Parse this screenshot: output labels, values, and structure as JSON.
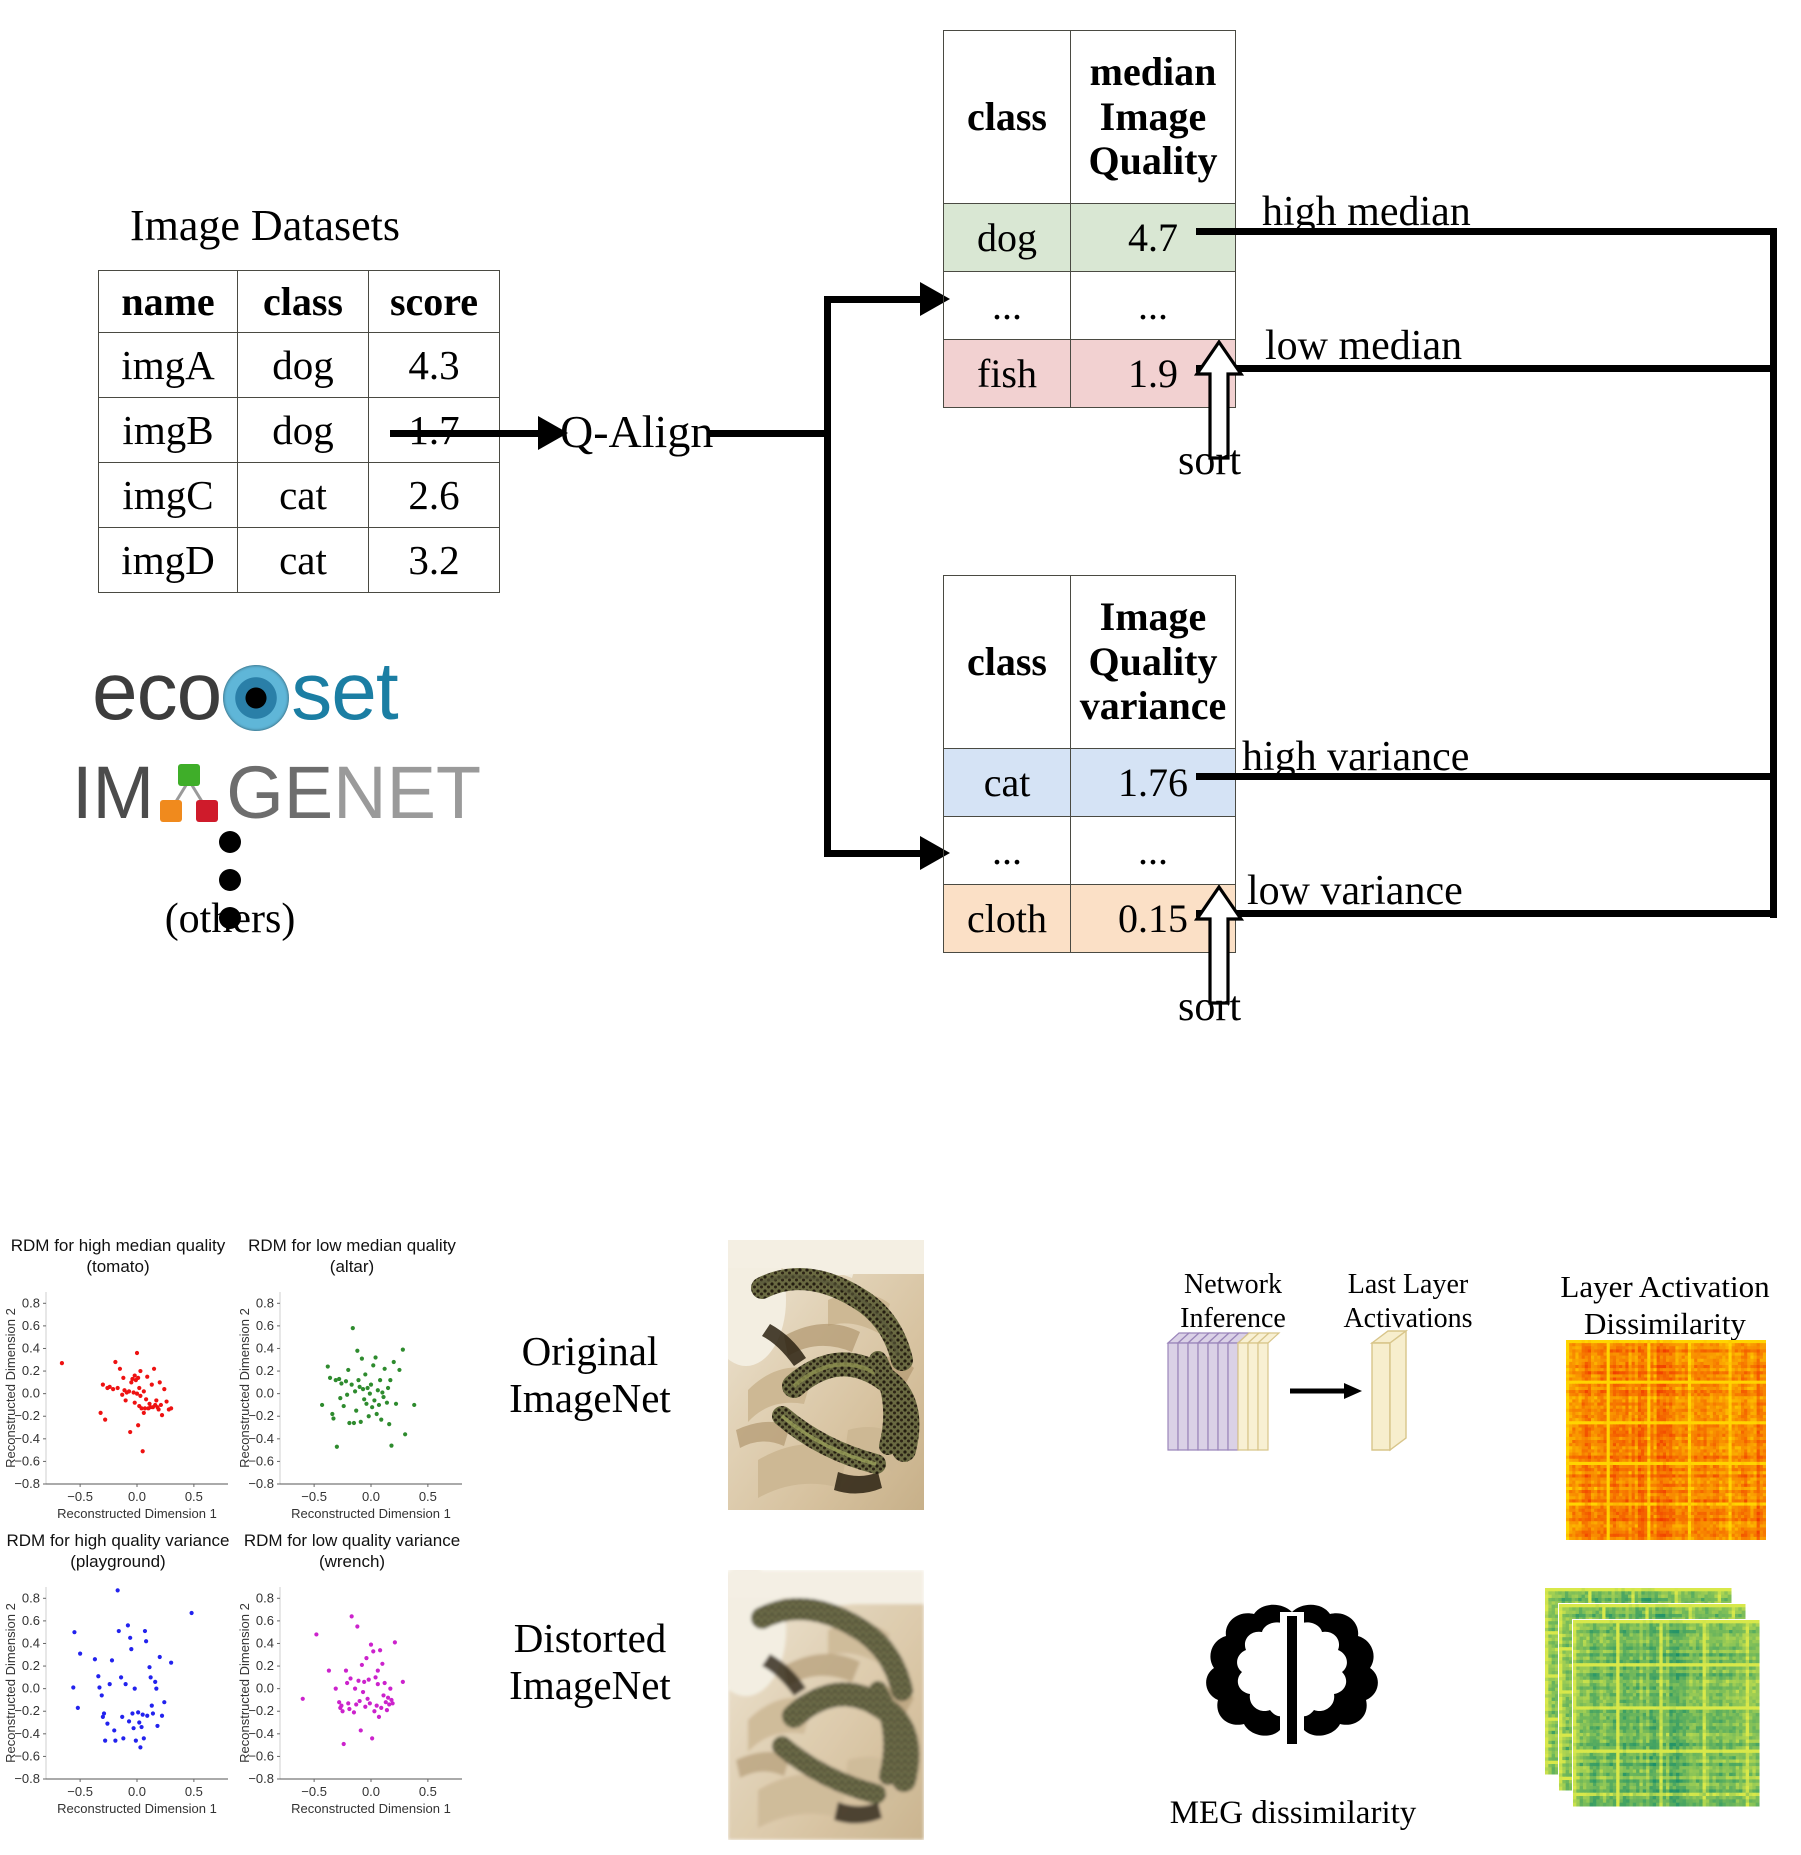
{
  "pipeline": {
    "dataset_title": "Image Datasets",
    "dataset_table": {
      "headers": [
        "name",
        "class",
        "score"
      ],
      "rows": [
        [
          "imgA",
          "dog",
          "4.3"
        ],
        [
          "imgB",
          "dog",
          "1.7"
        ],
        [
          "imgC",
          "cat",
          "2.6"
        ],
        [
          "imgD",
          "cat",
          "3.2"
        ]
      ]
    },
    "logos": {
      "ecoset_prefix": "eco",
      "ecoset_suffix": "set",
      "imagenet_part1": "IM",
      "imagenet_part2": "GE",
      "imagenet_part3": "NET",
      "others_label": "(others)"
    },
    "model_label": "Q-Align",
    "median_table": {
      "headers": [
        "class",
        "median Image Quality"
      ],
      "header_class": "class",
      "header_value_lines": [
        "median",
        "Image",
        "Quality"
      ],
      "rows": [
        {
          "class": "dog",
          "value": "4.7",
          "color": "#d9e7d3"
        },
        {
          "class": "...",
          "value": "...",
          "color": "#ffffff"
        },
        {
          "class": "fish",
          "value": "1.9",
          "color": "#f2d1d1"
        }
      ]
    },
    "variance_table": {
      "header_class": "class",
      "header_value_lines": [
        "Image",
        "Quality",
        "variance"
      ],
      "rows": [
        {
          "class": "cat",
          "value": "1.76",
          "color": "#d5e3f5"
        },
        {
          "class": "...",
          "value": "...",
          "color": "#ffffff"
        },
        {
          "class": "cloth",
          "value": "0.15",
          "color": "#fbe0c6"
        }
      ]
    },
    "branch_labels": {
      "high_median": "high median",
      "low_median": "low median",
      "high_variance": "high variance",
      "low_variance": "low variance"
    },
    "sort_label_top": "sort",
    "sort_label_bottom": "sort"
  },
  "analysis": {
    "image_row_labels": {
      "original": [
        "Original",
        "ImageNet"
      ],
      "distorted": [
        "Distorted",
        "ImageNet"
      ]
    },
    "network": {
      "inference_label": [
        "Network",
        "Inference"
      ],
      "activations_label": [
        "Last Layer",
        "Activations"
      ],
      "meg_label": "MEG dissimilarity",
      "dissimilarity_label": [
        "Layer Activation",
        "Dissimilarity"
      ]
    },
    "colors": {
      "network_layer": "#cdc2de",
      "last_layer": "#f7eecd",
      "heatmap_red": "#fb3b00",
      "heatmap_green": "#12936f"
    }
  },
  "chart_data": [
    {
      "type": "scatter",
      "title": "RDM for high median quality\n(tomato)",
      "title_line1": "RDM for high median quality",
      "title_line2": "(tomato)",
      "xlabel": "Reconstructed Dimension 1",
      "ylabel": "Reconstructed Dimension 2",
      "color": "#ee1111",
      "xlim": [
        -0.8,
        0.8
      ],
      "ylim": [
        -0.8,
        0.9
      ],
      "xticks": [
        -0.5,
        0.0,
        0.5
      ],
      "yticks": [
        -0.8,
        -0.6,
        -0.4,
        -0.2,
        0.0,
        0.2,
        0.4,
        0.6,
        0.8
      ],
      "points": [
        [
          -0.66,
          0.27
        ],
        [
          -0.32,
          -0.17
        ],
        [
          -0.28,
          -0.23
        ],
        [
          -0.24,
          0.06
        ],
        [
          -0.21,
          0.04
        ],
        [
          -0.19,
          0.28
        ],
        [
          -0.17,
          0.05
        ],
        [
          -0.15,
          0.22
        ],
        [
          -0.13,
          -0.01
        ],
        [
          -0.12,
          0.14
        ],
        [
          -0.11,
          0.03
        ],
        [
          -0.1,
          -0.06
        ],
        [
          -0.09,
          0.01
        ],
        [
          -0.07,
          0.02
        ],
        [
          -0.06,
          -0.34
        ],
        [
          -0.05,
          0.1
        ],
        [
          -0.04,
          0.13
        ],
        [
          -0.03,
          0.01
        ],
        [
          -0.02,
          -0.08
        ],
        [
          -0.02,
          0.16
        ],
        [
          -0.01,
          0.12
        ],
        [
          0.0,
          0.36
        ],
        [
          0.0,
          0.0
        ],
        [
          0.01,
          0.14
        ],
        [
          0.01,
          -0.28
        ],
        [
          0.02,
          -0.11
        ],
        [
          0.02,
          0.05
        ],
        [
          0.03,
          -0.02
        ],
        [
          0.03,
          0.2
        ],
        [
          0.04,
          -0.13
        ],
        [
          0.05,
          -0.51
        ],
        [
          0.06,
          -0.17
        ],
        [
          0.06,
          0.02
        ],
        [
          0.07,
          -0.13
        ],
        [
          0.08,
          -0.05
        ],
        [
          0.09,
          0.15
        ],
        [
          0.1,
          -0.13
        ],
        [
          0.11,
          -0.09
        ],
        [
          0.12,
          -0.12
        ],
        [
          0.13,
          0.08
        ],
        [
          0.14,
          -0.12
        ],
        [
          0.15,
          0.22
        ],
        [
          0.16,
          -0.1
        ],
        [
          0.17,
          -0.06
        ],
        [
          0.18,
          -0.12
        ],
        [
          0.2,
          0.1
        ],
        [
          0.21,
          -0.1
        ],
        [
          0.22,
          -0.19
        ],
        [
          0.24,
          0.04
        ],
        [
          0.26,
          -0.07
        ],
        [
          0.28,
          -0.14
        ],
        [
          0.3,
          -0.13
        ],
        [
          0.19,
          -0.14
        ],
        [
          -0.26,
          0.05
        ],
        [
          -0.3,
          0.08
        ]
      ]
    },
    {
      "type": "scatter",
      "title_line1": "RDM for low median quality",
      "title_line2": "(altar)",
      "xlabel": "Reconstructed Dimension 1",
      "ylabel": "Reconstructed Dimension 2",
      "color": "#2e8b2e",
      "xlim": [
        -0.8,
        0.8
      ],
      "ylim": [
        -0.8,
        0.9
      ],
      "xticks": [
        -0.5,
        0.0,
        0.5
      ],
      "yticks": [
        -0.8,
        -0.6,
        -0.4,
        -0.2,
        0.0,
        0.2,
        0.4,
        0.6,
        0.8
      ],
      "points": [
        [
          -0.43,
          -0.1
        ],
        [
          -0.38,
          0.24
        ],
        [
          -0.36,
          0.14
        ],
        [
          -0.34,
          -0.18
        ],
        [
          -0.33,
          -0.22
        ],
        [
          -0.31,
          0.12
        ],
        [
          -0.3,
          -0.47
        ],
        [
          -0.28,
          0.13
        ],
        [
          -0.27,
          -0.04
        ],
        [
          -0.26,
          0.09
        ],
        [
          -0.24,
          -0.11
        ],
        [
          -0.22,
          0.11
        ],
        [
          -0.21,
          -0.01
        ],
        [
          -0.2,
          0.21
        ],
        [
          -0.19,
          -0.26
        ],
        [
          -0.17,
          0.08
        ],
        [
          -0.16,
          0.58
        ],
        [
          -0.15,
          -0.26
        ],
        [
          -0.14,
          0.02
        ],
        [
          -0.13,
          -0.15
        ],
        [
          -0.12,
          0.38
        ],
        [
          -0.11,
          0.12
        ],
        [
          -0.1,
          0.06
        ],
        [
          -0.09,
          -0.25
        ],
        [
          -0.08,
          0.31
        ],
        [
          -0.07,
          0.04
        ],
        [
          -0.06,
          -0.05
        ],
        [
          -0.05,
          0.17
        ],
        [
          -0.04,
          -0.09
        ],
        [
          -0.03,
          0.05
        ],
        [
          -0.02,
          -0.2
        ],
        [
          -0.01,
          0.0
        ],
        [
          0.0,
          0.08
        ],
        [
          0.01,
          -0.12
        ],
        [
          0.02,
          0.25
        ],
        [
          0.03,
          -0.06
        ],
        [
          0.04,
          0.32
        ],
        [
          0.05,
          -0.18
        ],
        [
          0.06,
          0.03
        ],
        [
          0.07,
          -0.1
        ],
        [
          0.08,
          0.12
        ],
        [
          0.09,
          -0.23
        ],
        [
          0.1,
          0.01
        ],
        [
          0.11,
          -0.03
        ],
        [
          0.12,
          0.22
        ],
        [
          0.14,
          -0.08
        ],
        [
          0.15,
          0.05
        ],
        [
          0.16,
          -0.27
        ],
        [
          0.17,
          0.12
        ],
        [
          0.18,
          -0.46
        ],
        [
          0.2,
          0.28
        ],
        [
          0.22,
          -0.09
        ],
        [
          0.25,
          0.21
        ],
        [
          0.28,
          0.39
        ],
        [
          0.3,
          -0.36
        ],
        [
          0.38,
          -0.1
        ]
      ]
    },
    {
      "type": "scatter",
      "title_line1": "RDM for high quality variance",
      "title_line2": "(playground)",
      "xlabel": "Reconstructed Dimension 1",
      "ylabel": "Reconstructed Dimension 2",
      "color": "#2222ee",
      "xlim": [
        -0.8,
        0.8
      ],
      "ylim": [
        -0.8,
        0.9
      ],
      "xticks": [
        -0.5,
        0.0,
        0.5
      ],
      "yticks": [
        -0.8,
        -0.6,
        -0.4,
        -0.2,
        0.0,
        0.2,
        0.4,
        0.6,
        0.8
      ],
      "points": [
        [
          -0.55,
          0.5
        ],
        [
          -0.5,
          0.31
        ],
        [
          -0.56,
          0.01
        ],
        [
          -0.52,
          -0.17
        ],
        [
          -0.37,
          0.26
        ],
        [
          -0.34,
          0.11
        ],
        [
          -0.33,
          0.01
        ],
        [
          -0.31,
          -0.06
        ],
        [
          -0.3,
          -0.25
        ],
        [
          -0.29,
          -0.22
        ],
        [
          -0.28,
          -0.46
        ],
        [
          -0.26,
          -0.31
        ],
        [
          -0.22,
          0.25
        ],
        [
          -0.2,
          -0.37
        ],
        [
          -0.19,
          -0.46
        ],
        [
          -0.17,
          0.87
        ],
        [
          -0.16,
          0.51
        ],
        [
          -0.14,
          0.1
        ],
        [
          -0.13,
          -0.25
        ],
        [
          -0.12,
          -0.44
        ],
        [
          -0.1,
          0.04
        ],
        [
          -0.08,
          0.56
        ],
        [
          -0.07,
          -0.29
        ],
        [
          -0.06,
          0.45
        ],
        [
          -0.05,
          0.35
        ],
        [
          -0.04,
          -0.22
        ],
        [
          -0.03,
          -0.35
        ],
        [
          -0.02,
          0.0
        ],
        [
          -0.01,
          -0.46
        ],
        [
          0.01,
          -0.21
        ],
        [
          0.02,
          -0.3
        ],
        [
          0.03,
          -0.52
        ],
        [
          0.04,
          -0.34
        ],
        [
          0.05,
          -0.23
        ],
        [
          0.06,
          -0.44
        ],
        [
          0.07,
          0.51
        ],
        [
          0.08,
          0.42
        ],
        [
          0.09,
          -0.24
        ],
        [
          0.11,
          0.19
        ],
        [
          0.12,
          0.1
        ],
        [
          0.13,
          -0.15
        ],
        [
          0.14,
          -0.22
        ],
        [
          0.16,
          0.06
        ],
        [
          0.17,
          0.0
        ],
        [
          0.2,
          0.28
        ],
        [
          0.22,
          -0.24
        ],
        [
          0.24,
          -0.12
        ],
        [
          0.3,
          0.23
        ],
        [
          0.48,
          0.67
        ],
        [
          0.18,
          -0.33
        ],
        [
          -0.24,
          0.04
        ]
      ]
    },
    {
      "type": "scatter",
      "title_line1": "RDM for low quality variance",
      "title_line2": "(wrench)",
      "xlabel": "Reconstructed Dimension 1",
      "ylabel": "Reconstructed Dimension 2",
      "color": "#cc22cc",
      "xlim": [
        -0.8,
        0.8
      ],
      "ylim": [
        -0.8,
        0.9
      ],
      "xticks": [
        -0.5,
        0.0,
        0.5
      ],
      "yticks": [
        -0.8,
        -0.6,
        -0.4,
        -0.2,
        0.0,
        0.2,
        0.4,
        0.6,
        0.8
      ],
      "points": [
        [
          -0.6,
          -0.09
        ],
        [
          -0.48,
          0.48
        ],
        [
          -0.37,
          0.16
        ],
        [
          -0.31,
          0.0
        ],
        [
          -0.28,
          -0.12
        ],
        [
          -0.27,
          -0.17
        ],
        [
          -0.26,
          -0.15
        ],
        [
          -0.25,
          -0.2
        ],
        [
          -0.24,
          -0.49
        ],
        [
          -0.22,
          0.16
        ],
        [
          -0.21,
          0.05
        ],
        [
          -0.2,
          -0.13
        ],
        [
          -0.19,
          -0.18
        ],
        [
          -0.18,
          0.09
        ],
        [
          -0.17,
          0.64
        ],
        [
          -0.15,
          -0.21
        ],
        [
          -0.14,
          0.0
        ],
        [
          -0.13,
          -0.14
        ],
        [
          -0.12,
          0.55
        ],
        [
          -0.11,
          0.07
        ],
        [
          -0.1,
          -0.11
        ],
        [
          -0.09,
          -0.37
        ],
        [
          -0.08,
          0.21
        ],
        [
          -0.07,
          -0.03
        ],
        [
          -0.06,
          0.06
        ],
        [
          -0.05,
          -0.16
        ],
        [
          -0.04,
          0.27
        ],
        [
          -0.03,
          -0.09
        ],
        [
          -0.02,
          0.08
        ],
        [
          -0.01,
          -0.13
        ],
        [
          0.0,
          0.39
        ],
        [
          0.01,
          -0.44
        ],
        [
          0.02,
          0.33
        ],
        [
          0.03,
          -0.2
        ],
        [
          0.04,
          0.1
        ],
        [
          0.05,
          -0.15
        ],
        [
          0.06,
          0.04
        ],
        [
          0.07,
          -0.25
        ],
        [
          0.08,
          0.34
        ],
        [
          0.09,
          -0.17
        ],
        [
          0.1,
          0.22
        ],
        [
          0.11,
          -0.06
        ],
        [
          0.12,
          0.05
        ],
        [
          0.13,
          -0.12
        ],
        [
          0.14,
          -0.19
        ],
        [
          0.15,
          -0.08
        ],
        [
          0.16,
          -0.14
        ],
        [
          0.18,
          -0.1
        ],
        [
          0.19,
          -0.13
        ],
        [
          0.21,
          0.41
        ],
        [
          0.28,
          0.06
        ],
        [
          0.17,
          0.0
        ],
        [
          0.06,
          0.16
        ]
      ]
    }
  ]
}
